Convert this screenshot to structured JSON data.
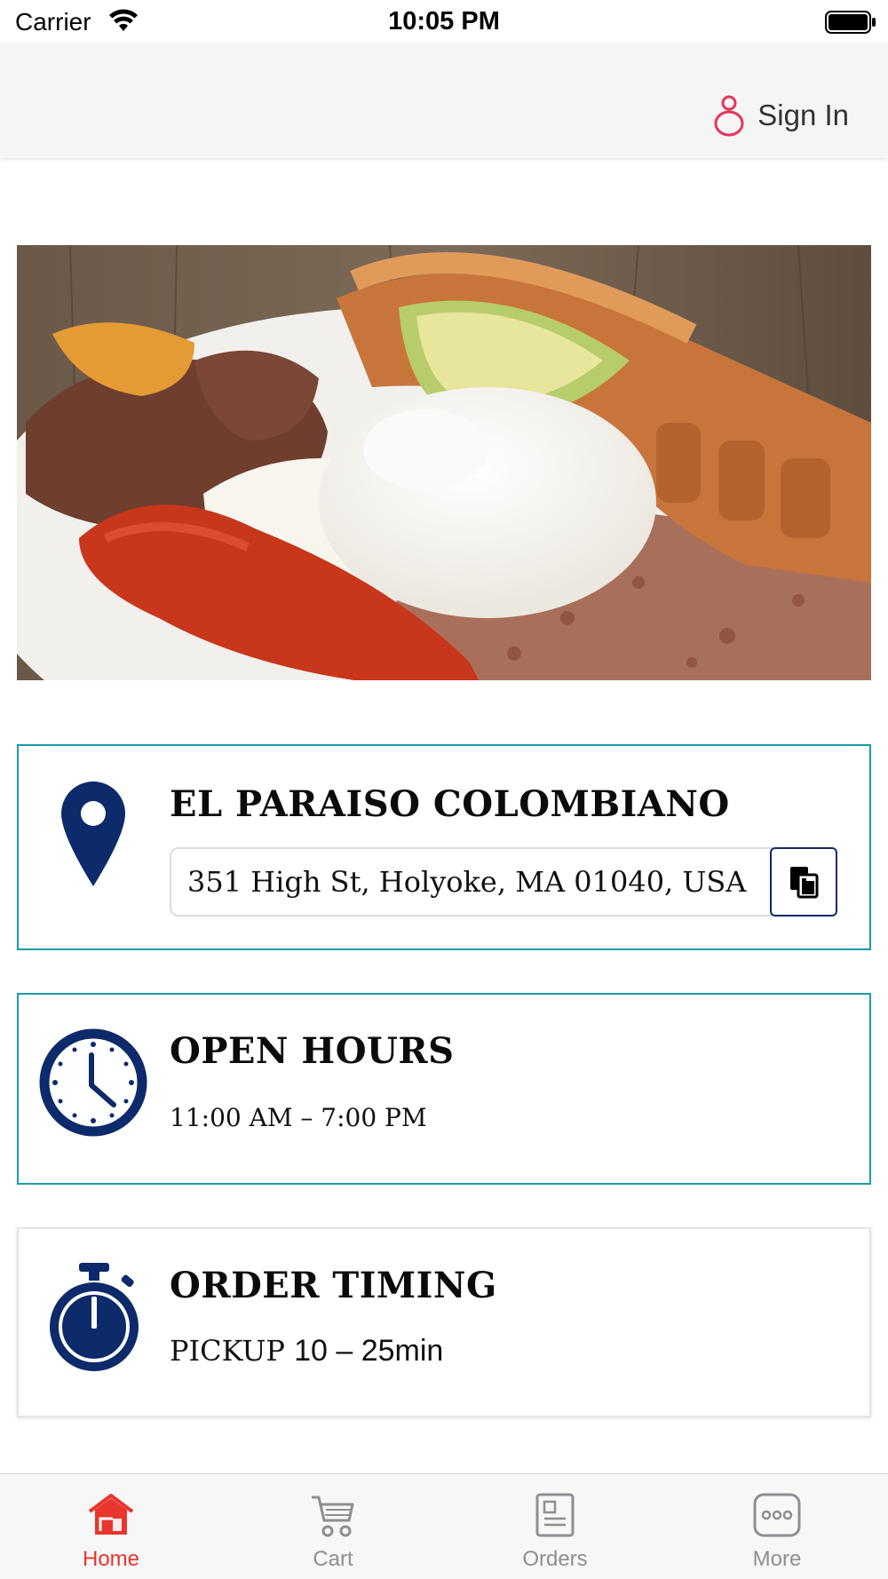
{
  "status_bar": {
    "carrier": "Carrier",
    "time": "10:05 PM"
  },
  "header": {
    "sign_in_label": "Sign In",
    "sign_in_icon": "user-icon",
    "accent_color": "#e8335a"
  },
  "hero": {
    "image_subject": "food-photo"
  },
  "location": {
    "icon": "map-pin-icon",
    "name": "EL PARAISO COLOMBIANO",
    "address": "351 High St, Holyoke, MA 01040, USA",
    "copy_icon": "copy-icon"
  },
  "hours": {
    "icon": "clock-icon",
    "title": "OPEN HOURS",
    "value": "11:00 AM – 7:00 PM"
  },
  "order_timing": {
    "icon": "stopwatch-icon",
    "title": "ORDER TIMING",
    "prefix": "PICKUP",
    "value": "10 – 25min"
  },
  "colors": {
    "navy": "#0d2a6b",
    "teal_border": "#1a9aaa",
    "tab_active": "#e8352e",
    "tab_inactive": "#8e8e93"
  },
  "tabs": [
    {
      "label": "Home",
      "icon": "home-icon",
      "active": true
    },
    {
      "label": "Cart",
      "icon": "cart-icon",
      "active": false
    },
    {
      "label": "Orders",
      "icon": "orders-icon",
      "active": false
    },
    {
      "label": "More",
      "icon": "more-icon",
      "active": false
    }
  ]
}
